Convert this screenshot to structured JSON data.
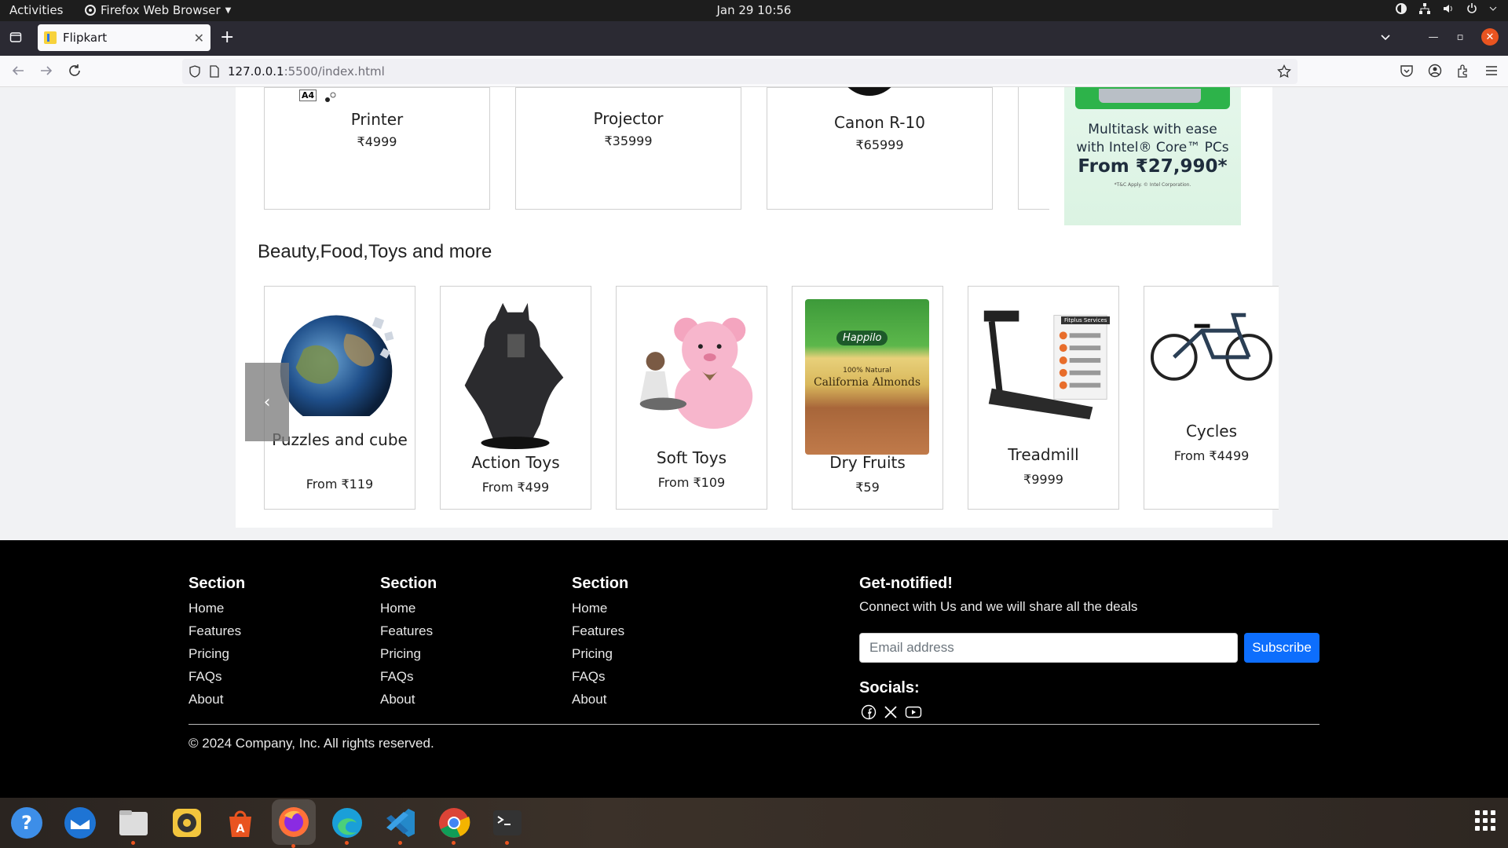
{
  "topbar": {
    "activities": "Activities",
    "app_menu": "Firefox Web Browser",
    "clock": "Jan 29  10:56"
  },
  "browser": {
    "tab_title": "Flipkart",
    "url_host": "127.0.0.1",
    "url_path": ":5500/index.html"
  },
  "electronics_row": [
    {
      "name": "Printer",
      "price": "₹4999"
    },
    {
      "name": "Projector",
      "price": "₹35999"
    },
    {
      "name": "Canon R-10",
      "price": "₹65999"
    }
  ],
  "printer_label": "A4",
  "banner": {
    "line1": "Multitask with ease",
    "line2": "with Intel® Core™ PCs",
    "line3": "From ₹27,990*",
    "fineprint": "*T&C Apply. © Intel Corporation."
  },
  "beauty_section": {
    "title": "Beauty,Food,Toys and more",
    "prev_icon": "‹",
    "products": [
      {
        "name": "Puzzles and cube",
        "price": "From ₹119",
        "image": "globe-puzzle"
      },
      {
        "name": "Action Toys",
        "price": "From ₹499",
        "image": "batman-figure"
      },
      {
        "name": "Soft Toys",
        "price": "From ₹109",
        "image": "pink-teddy"
      },
      {
        "name": "Dry Fruits",
        "price": "₹59",
        "image": "almonds-pack"
      },
      {
        "name": "Treadmill",
        "price": "₹9999",
        "image": "treadmill"
      },
      {
        "name": "Cycles",
        "price": "From ₹4499",
        "image": "bicycle"
      }
    ],
    "almond_brand": "Happilo",
    "almond_text": "California Almonds",
    "almond_sub": "100% Natural",
    "treadmill_badge": "Fitplus Services"
  },
  "footer": {
    "columns": [
      {
        "heading": "Section",
        "links": [
          "Home",
          "Features",
          "Pricing",
          "FAQs",
          "About"
        ]
      },
      {
        "heading": "Section",
        "links": [
          "Home",
          "Features",
          "Pricing",
          "FAQs",
          "About"
        ]
      },
      {
        "heading": "Section",
        "links": [
          "Home",
          "Features",
          "Pricing",
          "FAQs",
          "About"
        ]
      }
    ],
    "notify_title": "Get-notified!",
    "notify_sub": "Connect with Us and we will share all the deals",
    "email_placeholder": "Email address",
    "subscribe_label": "Subscribe",
    "socials_label": "Socials:",
    "copyright": "© 2024 Company, Inc. All rights reserved."
  },
  "colors": {
    "subscribe_blue": "#0d6efd",
    "footer_bg": "#000000",
    "ubuntu_orange": "#e95420",
    "page_bg": "#f1f2f4"
  },
  "dock_apps": [
    "help-icon",
    "thunderbird-icon",
    "files-icon",
    "rhythmbox-icon",
    "app-center-icon",
    "firefox-icon",
    "edge-icon",
    "vscode-icon",
    "chrome-icon",
    "terminal-icon"
  ]
}
